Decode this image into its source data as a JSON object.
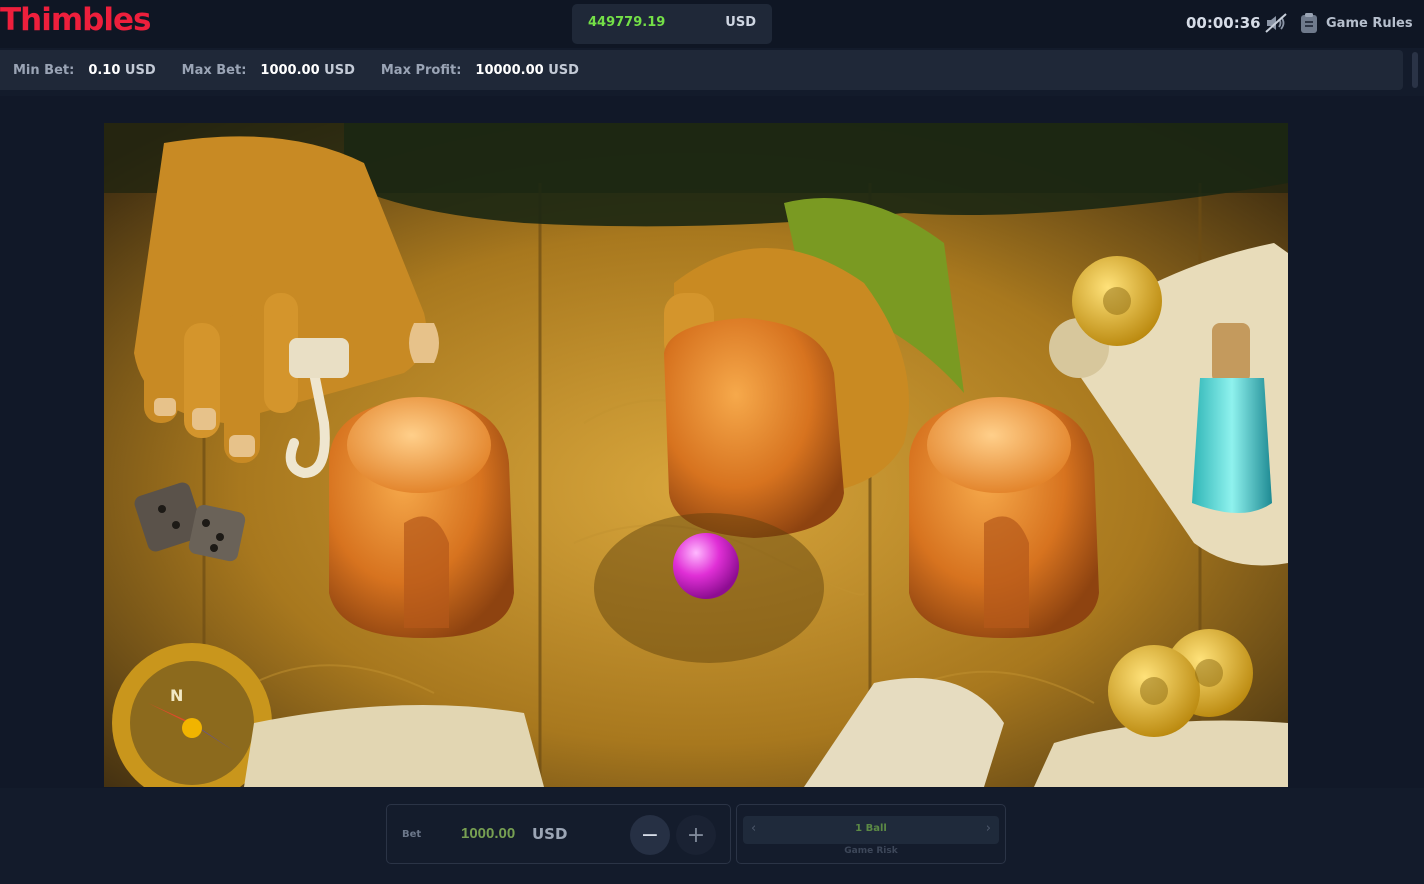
{
  "header": {
    "logo": "Thimbles",
    "balance": "449779.19",
    "balance_currency": "USD",
    "timer": "00:00:36",
    "sound_icon": "sound-off-icon",
    "rules_icon": "clipboard-icon",
    "rules_label": "Game Rules"
  },
  "limits": {
    "min_bet_label": "Min Bet:",
    "min_bet_value": "0.10",
    "min_bet_currency": "USD",
    "max_bet_label": "Max Bet:",
    "max_bet_value": "1000.00",
    "max_bet_currency": "USD",
    "max_profit_label": "Max Profit:",
    "max_profit_value": "10000.00",
    "max_profit_currency": "USD"
  },
  "bet": {
    "label": "Bet",
    "value": "1000.00",
    "currency": "USD",
    "minus": "−",
    "plus": "+"
  },
  "risk": {
    "value": "1 Ball",
    "caption": "Game Risk",
    "prev": "‹",
    "next": "›"
  },
  "scene": {
    "cup_count": 3,
    "ball_color": "#d21fd1",
    "table_color": "#b88a2c"
  }
}
